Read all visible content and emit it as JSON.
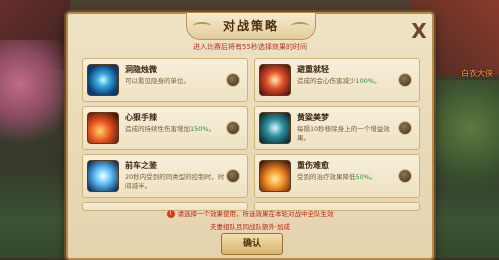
{
  "world": {
    "npc_tag": "白衣大侠"
  },
  "dialog": {
    "title": "对战策略",
    "close_label": "X",
    "subtitle": "进入比赛后将有55秒选择效果的时间",
    "cards": [
      {
        "name": "洞隐烛微",
        "desc": "可以看见隐身的单位。",
        "desc_hl": "",
        "icon": "eye-orb-icon",
        "selected": false
      },
      {
        "name": "避重就轻",
        "desc": "造成的会心伤害减少",
        "desc_hl": "100%。",
        "icon": "crossed-swords-icon",
        "selected": false
      },
      {
        "name": "心狠手辣",
        "desc": "造成的持续性伤害增加",
        "desc_hl": "150%。",
        "icon": "fire-claw-icon",
        "selected": false
      },
      {
        "name": "黄粱美梦",
        "desc": "每隔10秒移除身上的一个增益效果。",
        "desc_hl": "",
        "icon": "dream-orb-icon",
        "selected": false
      },
      {
        "name": "前车之鉴",
        "desc": "20秒内受到的同类型的控制时，时间减半。",
        "desc_hl": "",
        "icon": "frost-burst-icon",
        "selected": false
      },
      {
        "name": "重伤难愈",
        "desc": "受到的治疗效果降低",
        "desc_hl": "50%。",
        "icon": "flame-fist-icon",
        "selected": false
      }
    ],
    "notice_1": "请选择一个效果使用，所选效果在本轮对战中全队生效",
    "notice_2": "夫妻组队且同战队额外·加成",
    "confirm_label": "确认"
  }
}
